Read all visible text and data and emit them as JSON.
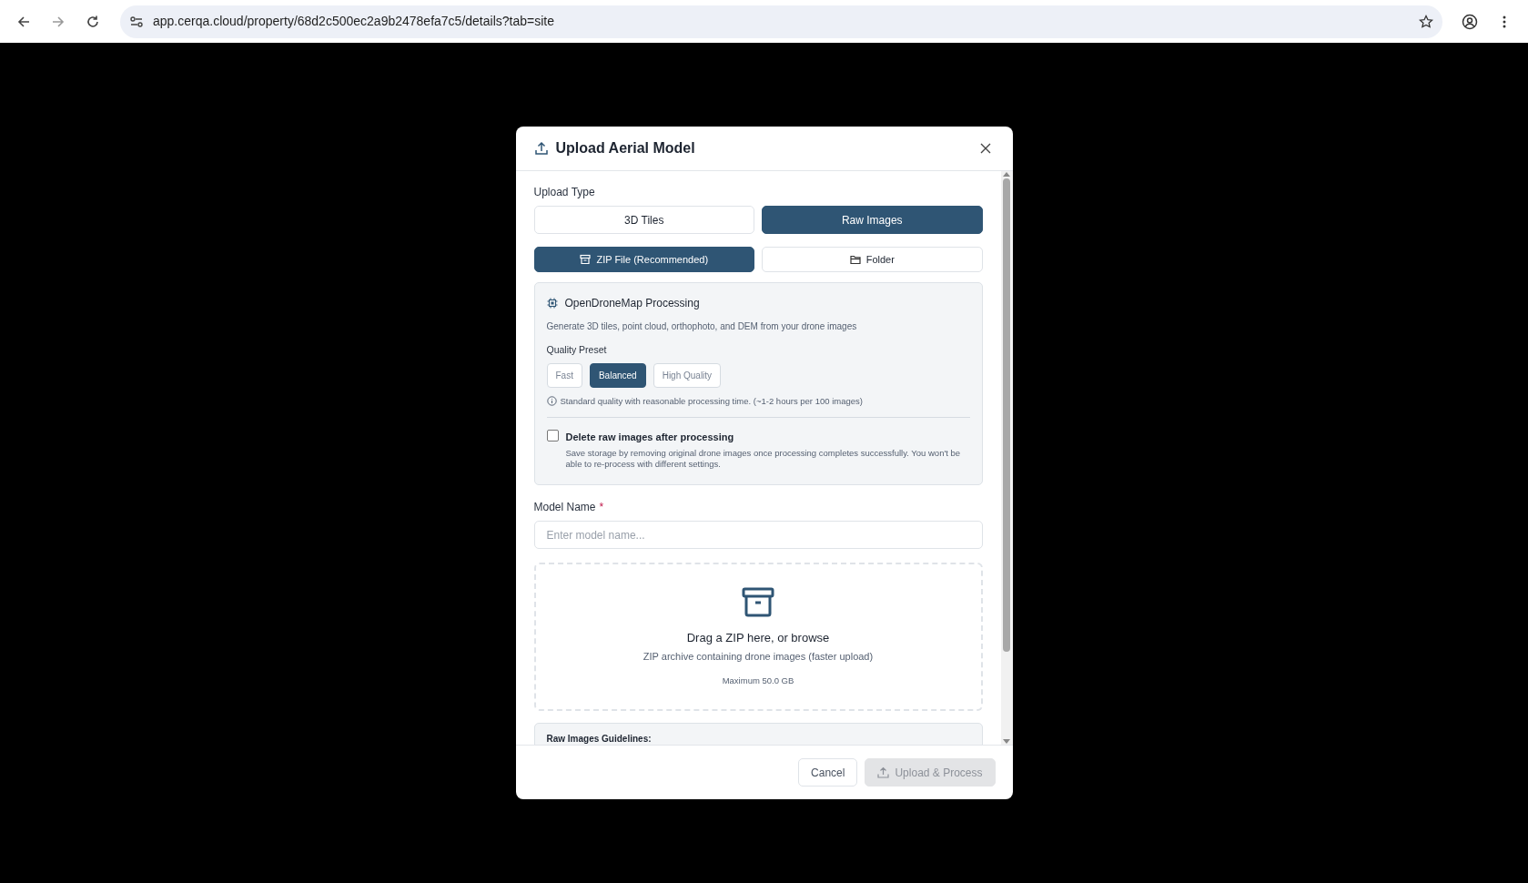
{
  "browser": {
    "url": "app.cerqa.cloud/property/68d2c500ec2a9b2478efa7c5/details?tab=site"
  },
  "modal": {
    "title": "Upload Aerial Model",
    "upload_type_label": "Upload Type",
    "type_options": [
      {
        "label": "3D Tiles",
        "selected": false
      },
      {
        "label": "Raw Images",
        "selected": true
      }
    ],
    "source_options": [
      {
        "label": "ZIP File (Recommended)",
        "kind": "zip",
        "selected": true
      },
      {
        "label": "Folder",
        "kind": "folder",
        "selected": false
      }
    ],
    "processing": {
      "title": "OpenDroneMap Processing",
      "description": "Generate 3D tiles, point cloud, orthophoto, and DEM from your drone images",
      "quality_label": "Quality Preset",
      "presets": [
        {
          "label": "Fast",
          "selected": false
        },
        {
          "label": "Balanced",
          "selected": true
        },
        {
          "label": "High Quality",
          "selected": false
        }
      ],
      "hint": "Standard quality with reasonable processing time. (~1-2 hours per 100 images)",
      "delete_option": {
        "label": "Delete raw images after processing",
        "checked": false,
        "description": "Save storage by removing original drone images once processing completes successfully. You won't be able to re-process with different settings."
      }
    },
    "model_name": {
      "label": "Model Name",
      "required_mark": "*",
      "placeholder": "Enter model name..."
    },
    "dropzone": {
      "title": "Drag a ZIP here, or browse",
      "subtitle": "ZIP archive containing drone images (faster upload)",
      "limit": "Maximum 50.0 GB"
    },
    "guidelines": {
      "title": "Raw Images Guidelines:"
    },
    "buttons": [
      {
        "label": "Cancel",
        "kind": "secondary",
        "disabled": false
      },
      {
        "label": "Upload & Process",
        "kind": "primary",
        "disabled": true
      }
    ]
  }
}
